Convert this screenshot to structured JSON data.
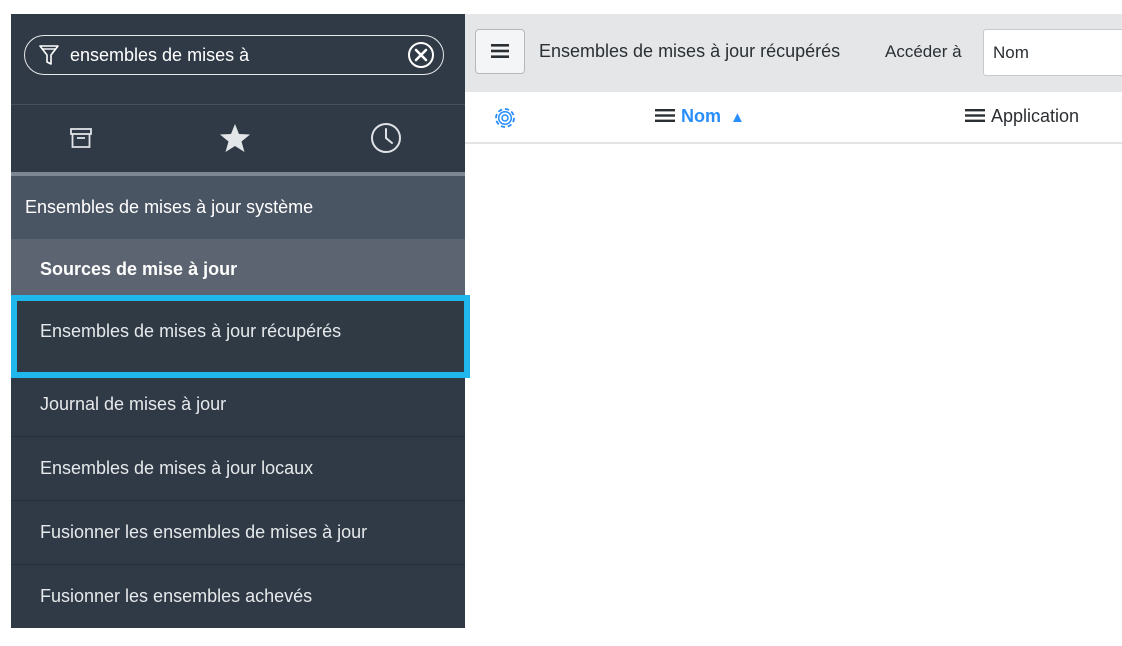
{
  "nav": {
    "filter_text": "ensembles de mises à",
    "tabs": [
      {
        "icon": "archive-icon"
      },
      {
        "icon": "star-icon"
      },
      {
        "icon": "clock-icon"
      }
    ],
    "modules": [
      {
        "label": "Ensembles de mises à jour système"
      },
      {
        "label": "Sources de mise à jour"
      },
      {
        "label": "Ensembles de mises à jour récupérés"
      },
      {
        "label": "Journal de mises à jour"
      },
      {
        "label": "Ensembles de mises à jour locaux"
      },
      {
        "label": "Fusionner les ensembles de mises à jour"
      },
      {
        "label": "Fusionner les ensembles achevés"
      }
    ],
    "highlight_color": "#1fb7ec"
  },
  "header": {
    "list_title": "Ensembles de mises à jour récupérés",
    "goto_label": "Accéder à",
    "goto_field_value": "Nom"
  },
  "columns": {
    "name": "Nom",
    "name_sort": "▲",
    "application": "Application"
  },
  "colors": {
    "nav_bg": "#303a46",
    "accent": "#278efc"
  }
}
